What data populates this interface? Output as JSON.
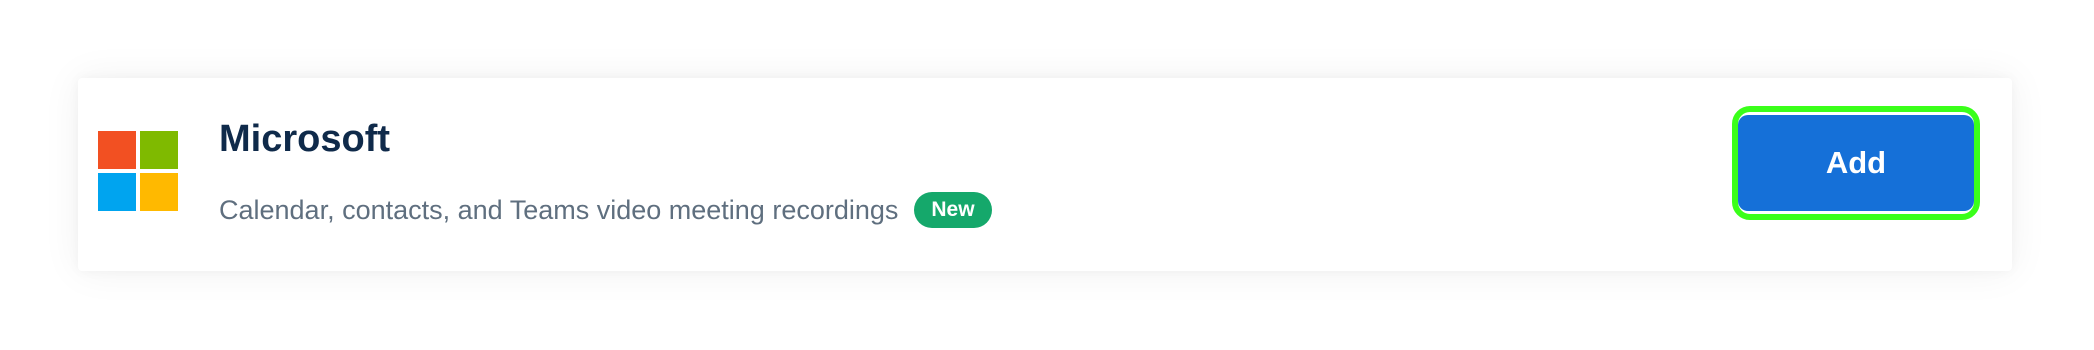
{
  "integration": {
    "name": "Microsoft",
    "description": "Calendar, contacts, and Teams video meeting recordings",
    "badge": "New",
    "logo_icon": "microsoft-logo-icon",
    "add_label": "Add"
  },
  "colors": {
    "title": "#0f2a4a",
    "description": "#5f6f7f",
    "badge_bg": "#15a86b",
    "button_bg": "#1570d8",
    "highlight": "#3aff1a",
    "logo_red": "#f25022",
    "logo_green": "#7fba00",
    "logo_blue": "#00a4ef",
    "logo_yellow": "#ffb900"
  }
}
